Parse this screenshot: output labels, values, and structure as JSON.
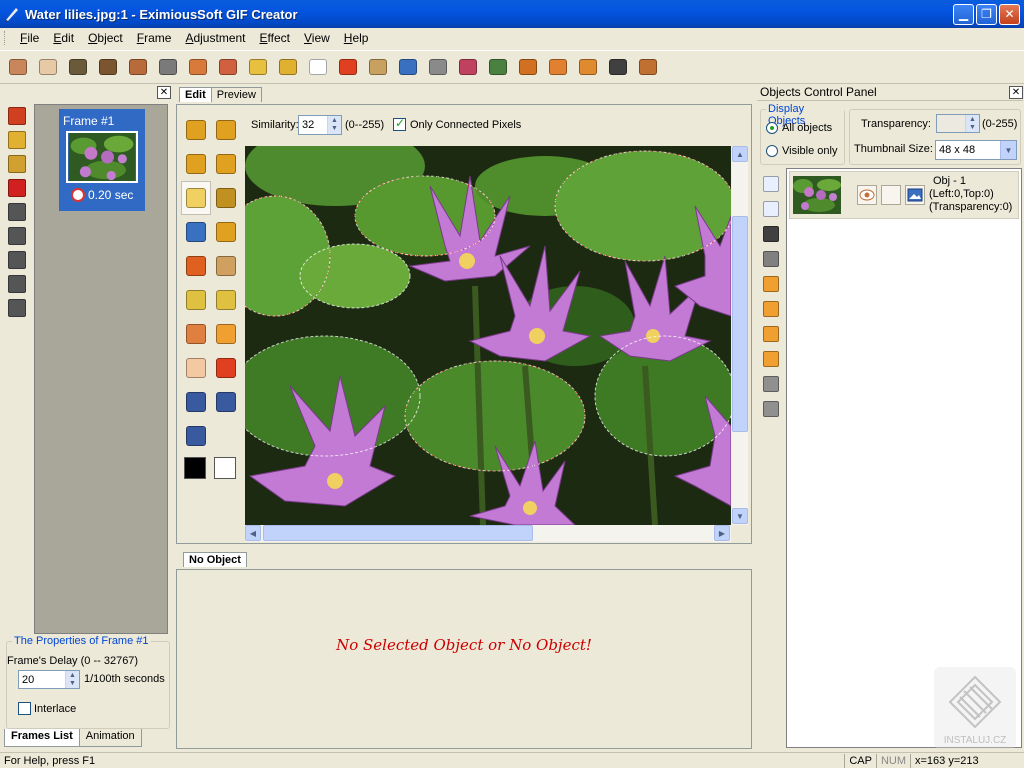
{
  "window": {
    "title": "Water lilies.jpg:1 - EximiousSoft GIF Creator"
  },
  "menu": [
    "File",
    "Edit",
    "Object",
    "Frame",
    "Adjustment",
    "Effect",
    "View",
    "Help"
  ],
  "toolbar_icons": [
    {
      "name": "new-shape-icon",
      "color": "#c9865a"
    },
    {
      "name": "eraser-icon",
      "color": "#e8c9a6"
    },
    {
      "name": "avi-icon",
      "color": "#6a5a3a"
    },
    {
      "name": "film-strip-icon",
      "color": "#7a5530"
    },
    {
      "name": "frames-icon",
      "color": "#b86a3a"
    },
    {
      "name": "printer-icon",
      "color": "#7a7a7a"
    },
    {
      "name": "wave-icon",
      "color": "#d87a3a"
    },
    {
      "name": "wave-red-icon",
      "color": "#d06040"
    },
    {
      "name": "diamond-yellow-icon",
      "color": "#e8c040"
    },
    {
      "name": "diamond-gold-icon",
      "color": "#e0b030"
    },
    {
      "name": "diamond-white-icon",
      "color": "#ffffff"
    },
    {
      "name": "stop-icon",
      "color": "#e04020"
    },
    {
      "name": "tag-icon",
      "color": "#c8a060"
    },
    {
      "name": "image-edit-icon",
      "color": "#3a70c0"
    },
    {
      "name": "tools-icon",
      "color": "#8a8a8a"
    },
    {
      "name": "paint-icon",
      "color": "#c04060"
    },
    {
      "name": "plant-icon",
      "color": "#4a8040"
    },
    {
      "name": "circle-orange-icon",
      "color": "#d07020"
    },
    {
      "name": "figure-icon",
      "color": "#e08030"
    },
    {
      "name": "phone-icon",
      "color": "#e08a30"
    },
    {
      "name": "cube-icon",
      "color": "#404040"
    },
    {
      "name": "bag-icon",
      "color": "#c07030"
    }
  ],
  "left_strip_icons": [
    {
      "name": "star-frame-icon",
      "color": "#d04020"
    },
    {
      "name": "frame-insert-icon",
      "color": "#e0b030"
    },
    {
      "name": "frame-copy-icon",
      "color": "#d0a030"
    },
    {
      "name": "frame-delete-icon",
      "color": "#d02020"
    },
    {
      "name": "frame-move-icon",
      "color": "#555555"
    },
    {
      "name": "frame-up-icon",
      "color": "#555555"
    },
    {
      "name": "frame-down-icon",
      "color": "#555555"
    },
    {
      "name": "frame-first-icon",
      "color": "#555555"
    },
    {
      "name": "frame-last-icon",
      "color": "#555555"
    }
  ],
  "frames": [
    {
      "label": "Frame #1",
      "delay": "0.20 sec"
    }
  ],
  "frame_props": {
    "legend": "The Properties of Frame #1",
    "delay_label": "Frame's Delay (0 -- 32767)",
    "delay_value": "20",
    "delay_unit": "1/100th seconds",
    "interlace_label": "Interlace",
    "interlace_checked": false
  },
  "bottom_tabs": [
    "Frames List",
    "Animation"
  ],
  "center_tabs": [
    "Edit",
    "Preview"
  ],
  "tools": [
    {
      "name": "select-arrow-icon",
      "color": "#e0a020"
    },
    {
      "name": "select-rect-icon",
      "color": "#e0a020"
    },
    {
      "name": "lasso-icon",
      "color": "#e0a020"
    },
    {
      "name": "poly-lasso-icon",
      "color": "#e0a020"
    },
    {
      "name": "magic-wand-icon",
      "color": "#f0d060"
    },
    {
      "name": "crop-icon",
      "color": "#c09020"
    },
    {
      "name": "image-icon",
      "color": "#3a70c0"
    },
    {
      "name": "text-icon",
      "color": "#e0a020"
    },
    {
      "name": "puzzle-icon",
      "color": "#e06020"
    },
    {
      "name": "pencil-icon",
      "color": "#d0a060"
    },
    {
      "name": "eraser-tool-icon",
      "color": "#e0c040"
    },
    {
      "name": "fill-icon",
      "color": "#e0c040"
    },
    {
      "name": "brush-icon",
      "color": "#e08040"
    },
    {
      "name": "rectangle-icon",
      "color": "#f0a030"
    },
    {
      "name": "ellipse-icon",
      "color": "#f4c8a0"
    },
    {
      "name": "polygon-icon",
      "color": "#e04020"
    },
    {
      "name": "zoom-in-icon",
      "color": "#3a5aa0"
    },
    {
      "name": "zoom-out-icon",
      "color": "#3a5aa0"
    },
    {
      "name": "zoom-icon",
      "color": "#3a5aa0"
    }
  ],
  "similarity": {
    "label": "Similarity:",
    "value": "32",
    "range": "(0--255)"
  },
  "only_connected": {
    "label": "Only Connected Pixels",
    "checked": true
  },
  "no_object": {
    "tab": "No Object",
    "message": "No Selected Object or No Object!"
  },
  "ocp": {
    "title": "Objects Control Panel",
    "display_legend": "Display Objects",
    "all_objects": "All objects",
    "visible_only": "Visible only",
    "transparency_label": "Transparency:",
    "transparency_range": "(0-255)",
    "thumb_size_label": "Thumbnail Size:",
    "thumb_size_value": "48 x 48"
  },
  "right_strip_icons": [
    {
      "name": "new-object-icon",
      "color": "#e8f0ff"
    },
    {
      "name": "copy-object-icon",
      "color": "#e8f0ff"
    },
    {
      "name": "delete-object-icon",
      "color": "#404040"
    },
    {
      "name": "cut-object-icon",
      "color": "#808080"
    },
    {
      "name": "object-front-icon",
      "color": "#f0a030"
    },
    {
      "name": "object-back-icon",
      "color": "#f0a030"
    },
    {
      "name": "object-up-icon",
      "color": "#f0a030"
    },
    {
      "name": "object-down-icon",
      "color": "#f0a030"
    },
    {
      "name": "object-merge-icon",
      "color": "#909090"
    },
    {
      "name": "object-properties-icon",
      "color": "#909090"
    }
  ],
  "objects": [
    {
      "name": "Obj - 1",
      "pos": "(Left:0,Top:0)",
      "transparency": "(Transparency:0)"
    }
  ],
  "watermark": "INSTALUJ.CZ",
  "status": {
    "message": "For Help, press F1",
    "cap": "CAP",
    "num": "NUM",
    "coords": "x=163 y=213"
  }
}
